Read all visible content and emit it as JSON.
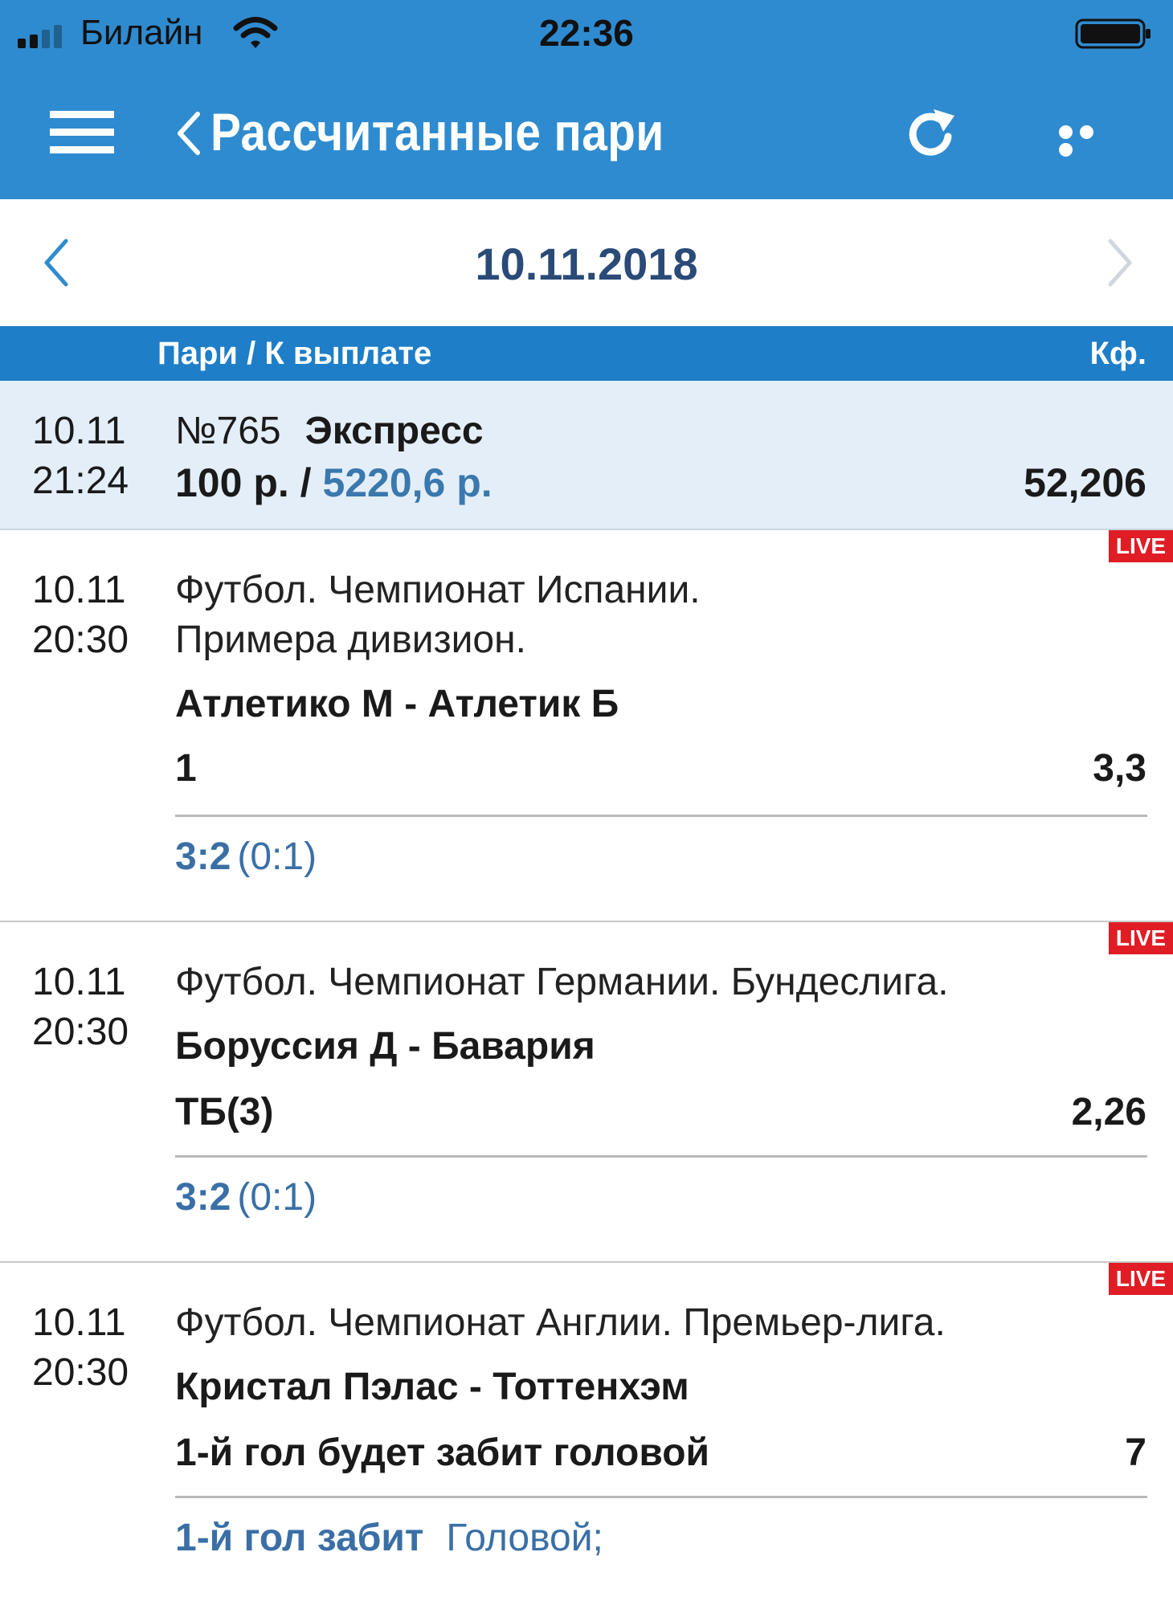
{
  "status_bar": {
    "carrier": "Билайн",
    "time": "22:36"
  },
  "nav": {
    "title": "Рассчитанные пари"
  },
  "date_selector": {
    "date": "10.11.2018"
  },
  "table_header": {
    "left": "Пари / К выплате",
    "right": "Кф."
  },
  "summary": {
    "date": "10.11",
    "time": "21:24",
    "number": "№765",
    "bet_type": "Экспресс",
    "stake": "100 р. / ",
    "payout": "5220,6 р.",
    "odds": "52,206"
  },
  "events": [
    {
      "live": "LIVE",
      "date": "10.11",
      "time": "20:30",
      "league_line1": "Футбол. Чемпионат Испании.",
      "league_line2": "Примера дивизион.",
      "teams": "Атлетико М - Атлетик Б",
      "pick": "1",
      "odds": "3,3",
      "score": "3:2",
      "halftime": "(0:1)"
    },
    {
      "live": "LIVE",
      "date": "10.11",
      "time": "20:30",
      "league_line1": "Футбол. Чемпионат Германии. Бундеслига.",
      "teams": "Боруссия Д - Бавария",
      "pick": "ТБ(3)",
      "odds": "2,26",
      "score": "3:2",
      "halftime": "(0:1)"
    },
    {
      "live": "LIVE",
      "date": "10.11",
      "time": "20:30",
      "league_line1": "Футбол. Чемпионат Англии. Премьер-лига.",
      "teams": "Кристал Пэлас - Тоттенхэм",
      "pick": "1-й гол будет забит головой",
      "odds": "7",
      "result_label": "1-й гол забит",
      "result_value": "Головой;"
    }
  ],
  "icons": {
    "menu": "hamburger-menu-icon",
    "back": "chevron-left-icon",
    "refresh": "refresh-icon",
    "more": "more-dots-icon",
    "date_prev": "chevron-left-icon",
    "date_next": "chevron-right-icon"
  },
  "colors": {
    "header_bg": "#2f8bcf",
    "table_header_bg": "#1e7ec8",
    "summary_bg": "#e4eef8",
    "accent_text": "#3a6fa6",
    "live_badge": "#e01d25"
  }
}
